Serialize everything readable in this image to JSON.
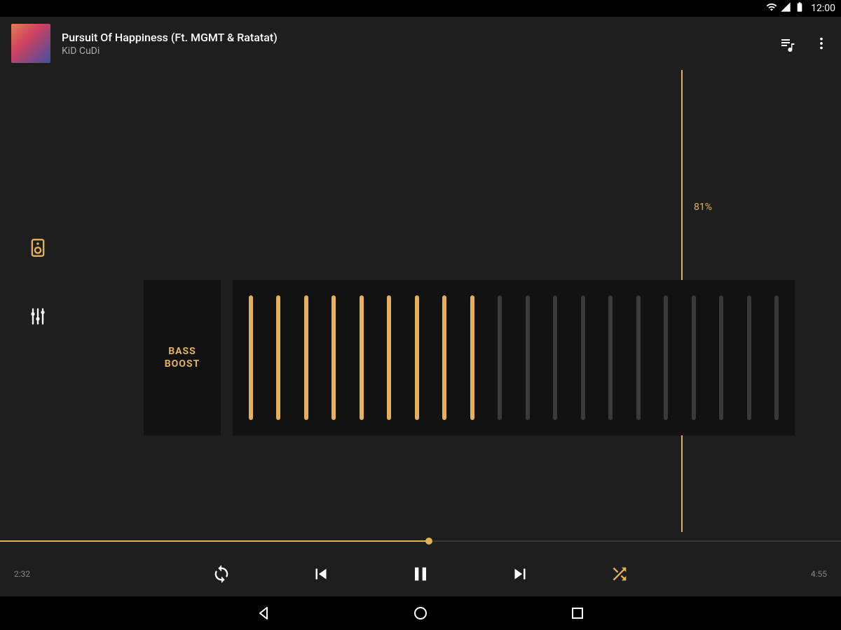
{
  "status": {
    "time": "12:00"
  },
  "header": {
    "track_title": "Pursuit Of Happiness (Ft. MGMT & Ratatat)",
    "artist": "KiD CuDi"
  },
  "volume": {
    "percent_label": "81%",
    "percent": 81
  },
  "bass": {
    "label": "BASS\nBOOST"
  },
  "equalizer": {
    "total_bars": 20,
    "active_bars": 9
  },
  "playback": {
    "elapsed": "2:32",
    "total": "4:55",
    "progress_percent": 51
  },
  "colors": {
    "accent": "#e4b25a"
  }
}
